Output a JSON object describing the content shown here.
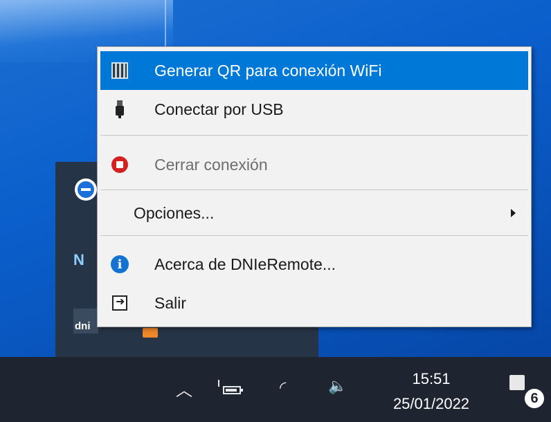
{
  "context_menu": {
    "items": [
      {
        "label": "Generar QR para conexión WiFi",
        "icon": "qr-code-icon",
        "selected": true
      },
      {
        "label": "Conectar por USB",
        "icon": "usb-icon"
      },
      {
        "label": "Cerrar conexión",
        "icon": "stop-icon",
        "disabled": true
      },
      {
        "label": "Opciones...",
        "has_submenu": true
      },
      {
        "label": "Acerca de DNIeRemote...",
        "icon": "info-icon"
      },
      {
        "label": "Salir",
        "icon": "exit-icon"
      }
    ]
  },
  "tray_flyout": {
    "icons": [
      "teamviewer-icon",
      "nx-icon",
      "dnie-remote-icon",
      "orange-app-icon"
    ],
    "dni_label": "dni"
  },
  "taskbar": {
    "time": "15:51",
    "date": "25/01/2022",
    "notification_count": "6",
    "icons": [
      "chevron-up-icon",
      "battery-icon",
      "wifi-icon",
      "volume-icon",
      "notification-icon"
    ]
  },
  "colors": {
    "selection": "#0078d7",
    "taskbar": "#1e2430",
    "desktop": "#0b5fcc"
  }
}
